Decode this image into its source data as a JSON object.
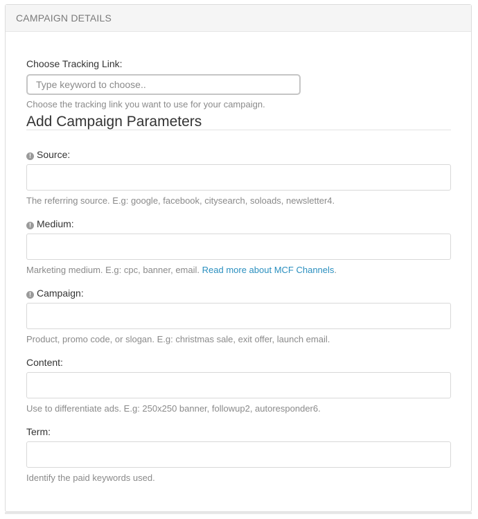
{
  "panel": {
    "title": "CAMPAIGN DETAILS"
  },
  "tracking": {
    "label": "Choose Tracking Link:",
    "placeholder": "Type keyword to choose..",
    "help": "Choose the tracking link you want to use for your campaign."
  },
  "params": {
    "title": "Add Campaign Parameters",
    "source": {
      "label": "Source:",
      "value": "",
      "help": "The referring source. E.g: google, facebook, citysearch, soloads, newsletter4."
    },
    "medium": {
      "label": "Medium:",
      "value": "",
      "help": "Marketing medium. E.g: cpc, banner, email.",
      "link": "Read more about MCF Channels",
      "help_end": "."
    },
    "campaign": {
      "label": "Campaign:",
      "value": "",
      "help": "Product, promo code, or slogan. E.g: christmas sale, exit offer, launch email."
    },
    "content": {
      "label": "Content:",
      "value": "",
      "help": "Use to differentiate ads. E.g: 250x250 banner, followup2, autoresponder6."
    },
    "term": {
      "label": "Term:",
      "value": "",
      "help": "Identify the paid keywords used."
    }
  }
}
